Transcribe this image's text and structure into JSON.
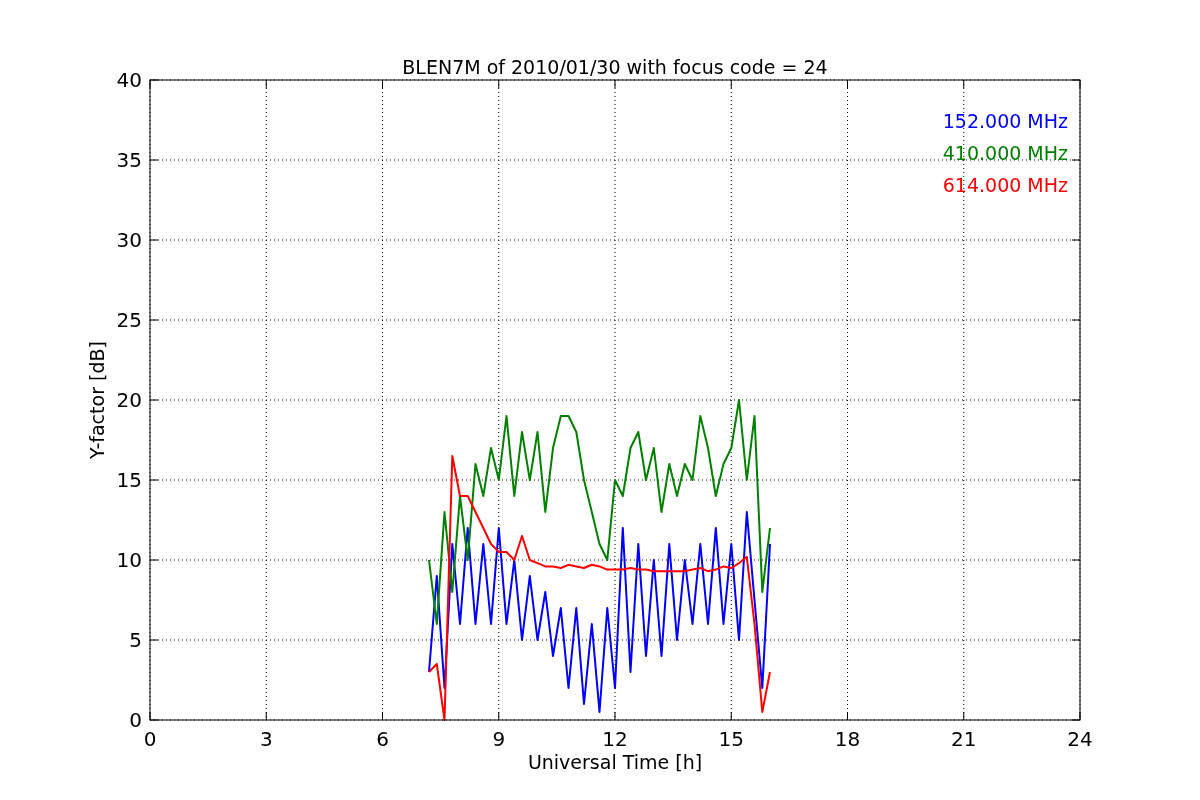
{
  "figure": {
    "chart_data": {
      "type": "line",
      "title": "BLEN7M of 2010/01/30 with focus code = 24",
      "xlabel": "Universal Time [h]",
      "ylabel": "Y-factor [dB]",
      "x": [
        7.2,
        7.4,
        7.6,
        7.8,
        8.0,
        8.2,
        8.4,
        8.6,
        8.8,
        9.0,
        9.2,
        9.4,
        9.6,
        9.8,
        10.0,
        10.2,
        10.4,
        10.6,
        10.8,
        11.0,
        11.2,
        11.4,
        11.6,
        11.8,
        12.0,
        12.2,
        12.4,
        12.6,
        12.8,
        13.0,
        13.2,
        13.4,
        13.6,
        13.8,
        14.0,
        14.2,
        14.4,
        14.6,
        14.8,
        15.0,
        15.2,
        15.4,
        15.6,
        15.8,
        16.0
      ],
      "series": [
        {
          "name": "152.000 MHz",
          "color": "#0000ff",
          "values": [
            3,
            9,
            2,
            11,
            6,
            12,
            6,
            11,
            6,
            12,
            6,
            10,
            5,
            9,
            5,
            8,
            4,
            7,
            2,
            7,
            1,
            6,
            0.5,
            7,
            2,
            12,
            3,
            11,
            4,
            10,
            4,
            11,
            5,
            10,
            6,
            11,
            6,
            12,
            6,
            11,
            5,
            13,
            7.5,
            2,
            11
          ]
        },
        {
          "name": "410.000 MHz",
          "color": "#008000",
          "values": [
            10,
            6,
            13,
            8,
            14,
            10,
            16,
            14,
            17,
            15,
            19,
            14,
            18,
            15,
            18,
            13,
            17,
            19,
            19,
            18,
            15,
            13,
            11,
            10,
            15,
            14,
            17,
            18,
            15,
            17,
            13,
            16,
            14,
            16,
            15,
            19,
            17,
            14,
            16,
            17,
            20,
            15,
            19,
            8,
            12
          ]
        },
        {
          "name": "614.000 MHz",
          "color": "#ff0000",
          "values": [
            3,
            3.5,
            0,
            16.5,
            14,
            14,
            13,
            12,
            11,
            10.5,
            10.5,
            10,
            11.5,
            10,
            9.8,
            9.6,
            9.6,
            9.5,
            9.7,
            9.6,
            9.5,
            9.7,
            9.6,
            9.4,
            9.4,
            9.4,
            9.5,
            9.4,
            9.4,
            9.3,
            9.3,
            9.3,
            9.3,
            9.3,
            9.4,
            9.5,
            9.3,
            9.4,
            9.6,
            9.5,
            9.8,
            10.2,
            6,
            0.5,
            3
          ]
        }
      ],
      "grid": true,
      "xlim": [
        0,
        24
      ],
      "ylim": [
        0,
        40
      ],
      "xticks": [
        0,
        3,
        6,
        9,
        12,
        15,
        18,
        21,
        24
      ],
      "yticks": [
        0,
        5,
        10,
        15,
        20,
        25,
        30,
        35,
        40
      ]
    }
  }
}
